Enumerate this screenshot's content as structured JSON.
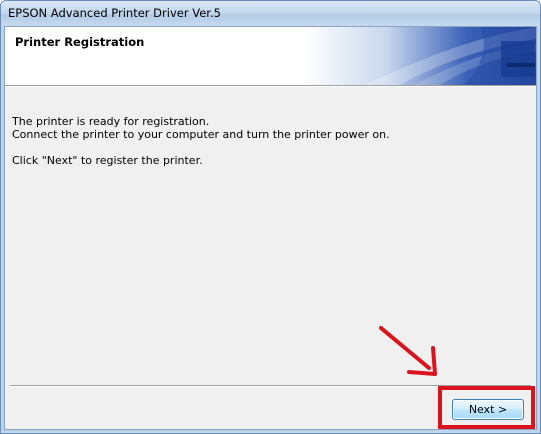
{
  "window": {
    "title": "EPSON Advanced Printer Driver Ver.5"
  },
  "header": {
    "title": "Printer Registration"
  },
  "content": {
    "line1": "The printer is ready for registration.",
    "line2": "Connect the printer to your computer and turn the printer power on.",
    "line3": "Click \"Next\" to register the printer."
  },
  "footer": {
    "next_label": "Next >"
  },
  "colors": {
    "accent": "#1f4aa0",
    "annotation": "#d9141e"
  }
}
